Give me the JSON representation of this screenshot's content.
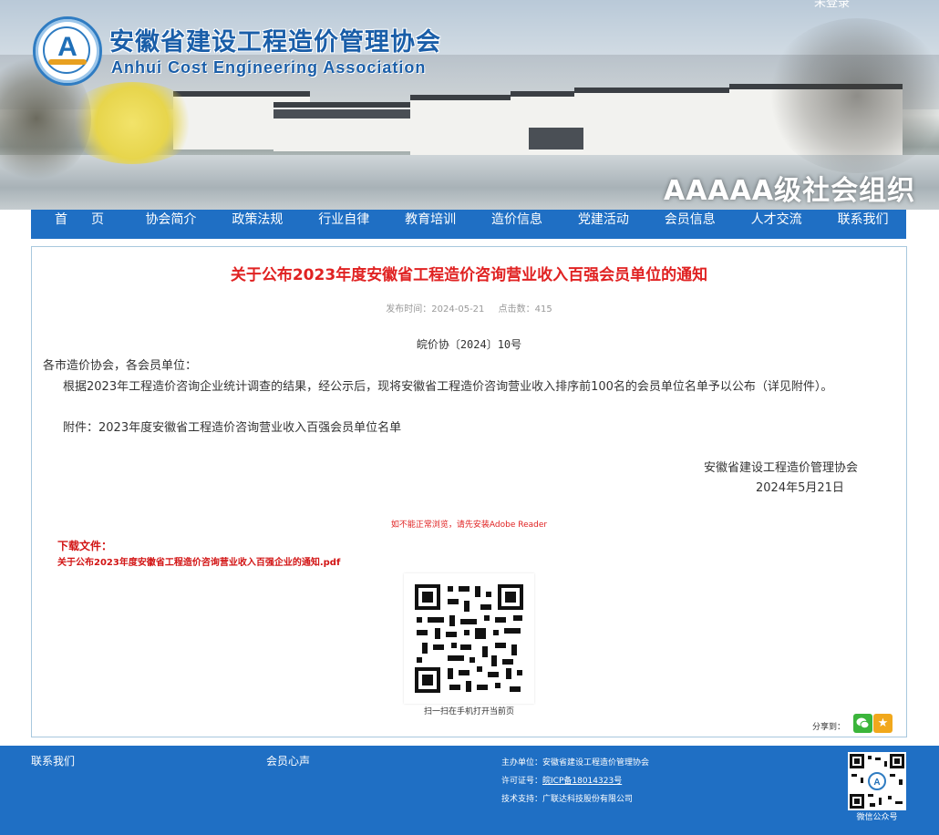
{
  "header": {
    "org_name_cn": "安徽省建设工程造价管理协会",
    "org_name_en": "Anhui Cost Engineering Association",
    "login_link": "未登录",
    "slogan": "AAAAA级社会组织",
    "logo_letter": "A"
  },
  "nav": {
    "items": [
      "首页",
      "协会简介",
      "政策法规",
      "行业自律",
      "教育培训",
      "造价信息",
      "党建活动",
      "会员信息",
      "人才交流",
      "联系我们"
    ]
  },
  "article": {
    "title": "关于公布2023年度安徽省工程造价咨询营业收入百强会员单位的通知",
    "publish_label": "发布时间：2024-05-21",
    "clicks_label": "点击数：415",
    "doc_number": "皖价协〔2024〕10号",
    "salutation": "各市造价协会，各会员单位：",
    "body": "根据2023年工程造价咨询企业统计调查的结果，经公示后，现将安徽省工程造价咨询营业收入排序前100名的会员单位名单予以公布（详见附件）。",
    "attachment": "附件：2023年度安徽省工程造价咨询营业收入百强会员单位名单",
    "signature_org": "安徽省建设工程造价管理协会",
    "signature_date": "2024年5月21日",
    "reader_tip": "如不能正常浏览，请先安装Adobe Reader",
    "download_label": "下载文件：",
    "download_file": "关于公布2023年度安徽省工程造价咨询营业收入百强企业的通知.pdf",
    "qr_caption": "扫一扫在手机打开当前页",
    "share_label": "分享到："
  },
  "footer": {
    "contact": "联系我们",
    "voice": "会员心声",
    "host": "主办单位：安徽省建设工程造价管理协会",
    "license_label": "许可证号：",
    "license_value": "皖ICP备18014323号",
    "tech": "技术支持：广联达科技股份有限公司",
    "wechat_caption": "微信公众号"
  },
  "colors": {
    "nav_blue": "#1f6fc4",
    "title_red": "#e02222",
    "org_blue": "#1a5ea8"
  }
}
